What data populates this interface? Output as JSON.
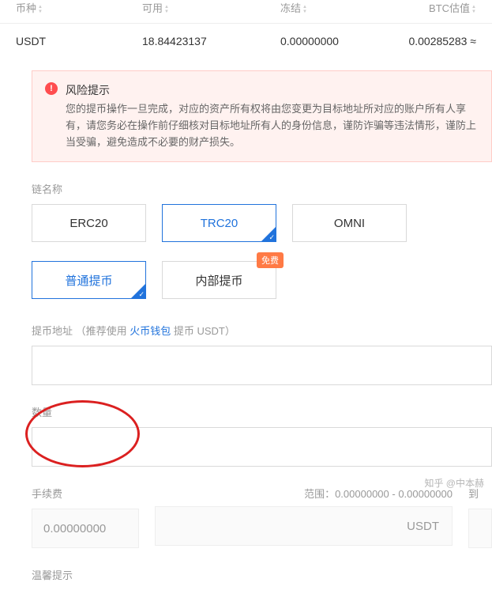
{
  "table": {
    "headers": {
      "currency": "币种",
      "available": "可用",
      "frozen": "冻结",
      "btc_value": "BTC估值"
    },
    "row": {
      "currency": "USDT",
      "available": "18.84423137",
      "frozen": "0.00000000",
      "btc_value": "0.00285283 ≈"
    }
  },
  "alert": {
    "title": "风险提示",
    "text": "您的提币操作一旦完成，对应的资产所有权将由您变更为目标地址所对应的账户所有人享有，请您务必在操作前仔细核对目标地址所有人的身份信息，谨防诈骗等违法情形，谨防上当受骗，避免造成不必要的财产损失。"
  },
  "chain": {
    "label": "链名称",
    "options": {
      "erc20": "ERC20",
      "trc20": "TRC20",
      "omni": "OMNI"
    }
  },
  "withdraw": {
    "normal": "普通提币",
    "internal": "内部提币",
    "badge": "免费"
  },
  "address": {
    "prefix": "提币地址 （推荐使用 ",
    "link": "火币钱包",
    "suffix": " 提币 USDT）"
  },
  "amount": {
    "label": "数量"
  },
  "fee": {
    "label": "手续费",
    "value": "0.00000000",
    "range": "范围：0.00000000 - 0.00000000",
    "arrive_label": "到",
    "suffix": "USDT"
  },
  "warm_tip": "温馨提示",
  "watermark": "知乎 @中本赫"
}
